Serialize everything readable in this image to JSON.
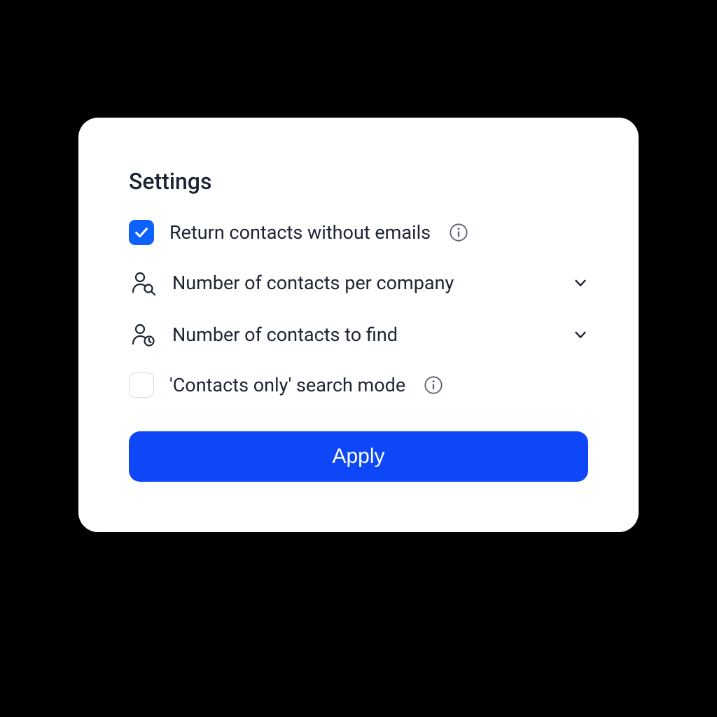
{
  "panel": {
    "title": "Settings",
    "apply_label": "Apply"
  },
  "options": {
    "return_without_emails": {
      "label": "Return contacts without emails",
      "checked": true
    },
    "contacts_per_company": {
      "label": "Number of contacts per company"
    },
    "contacts_to_find": {
      "label": "Number of contacts to find"
    },
    "contacts_only_mode": {
      "label": "'Contacts only' search mode",
      "checked": false
    }
  },
  "colors": {
    "accent": "#0d62fe",
    "button": "#0d47f7",
    "text": "#1d2433"
  }
}
